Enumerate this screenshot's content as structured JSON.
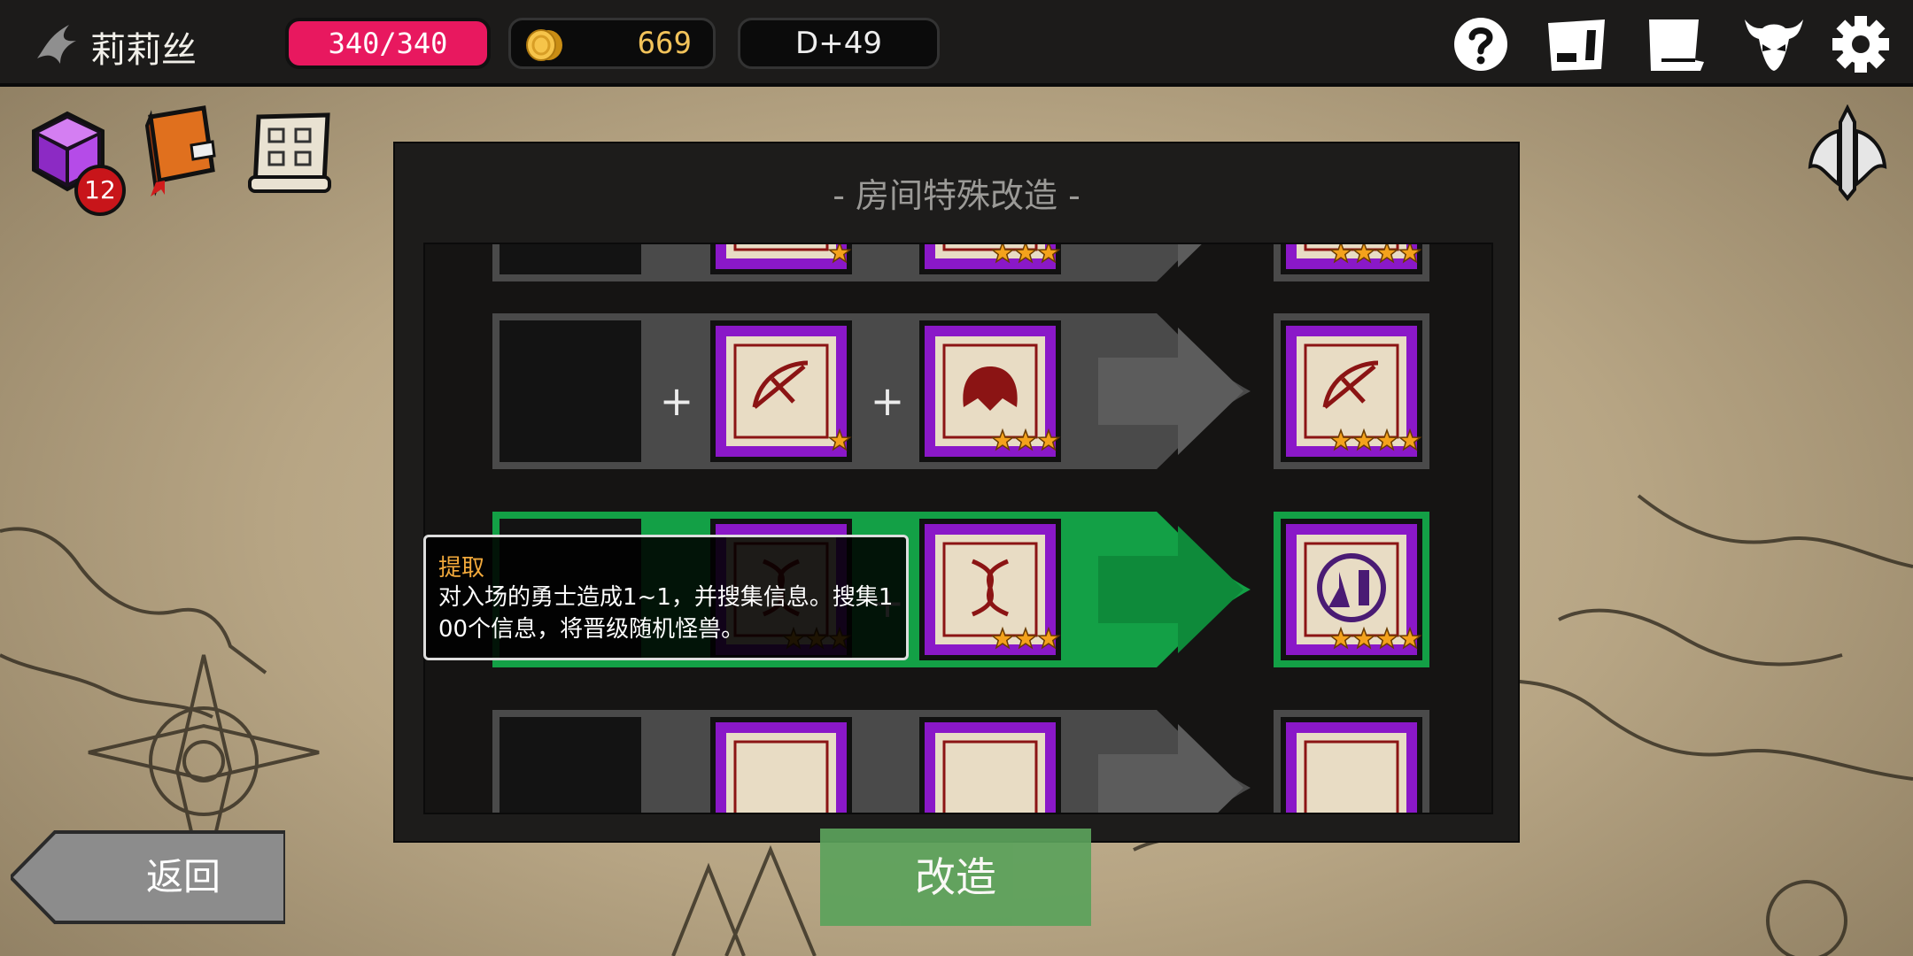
{
  "topbar": {
    "player_name": "莉莉丝",
    "hp": "340/340",
    "gold": "669",
    "day": "D+49",
    "icons": [
      "help-icon",
      "card-icon",
      "scroll-icon",
      "demon-helmet-icon",
      "gear-icon"
    ]
  },
  "left_icons": {
    "cube_badge": "12",
    "icons": [
      "purple-cube-icon",
      "book-icon",
      "blueprint-scroll-icon"
    ]
  },
  "right_icon": "winged-sword-emblem-icon",
  "dialog": {
    "title": "-  房间特殊改造  -",
    "plus": "+",
    "rows": [
      {
        "state": "partial",
        "slot2_stars": 1,
        "slot3_stars": 3,
        "result_stars": 4
      },
      {
        "state": "normal",
        "slot2_stars": 1,
        "slot3_stars": 3,
        "result_stars": 4,
        "slot2_icon": "crossbow-icon",
        "slot3_icon": "monster-icon",
        "result_icon": "crossbow-icon"
      },
      {
        "state": "selected",
        "slot2_stars": 3,
        "slot3_stars": 3,
        "result_stars": 4,
        "slot2_icon": "dna-icon",
        "slot3_icon": "dna-icon",
        "result_icon": "lab-flask-gear-icon"
      },
      {
        "state": "partial"
      }
    ]
  },
  "tooltip": {
    "title": "提取",
    "body": "对入场的勇士造成1~1，并搜集信息。搜集100个信息，将晋级随机怪兽。"
  },
  "buttons": {
    "back": "返回",
    "modify": "改造"
  },
  "colors": {
    "hp": "#e8185f",
    "gold": "#f2c35a",
    "selected_row": "#13a046",
    "slot_purple": "#8a18c8",
    "star": "#f4a21c"
  }
}
